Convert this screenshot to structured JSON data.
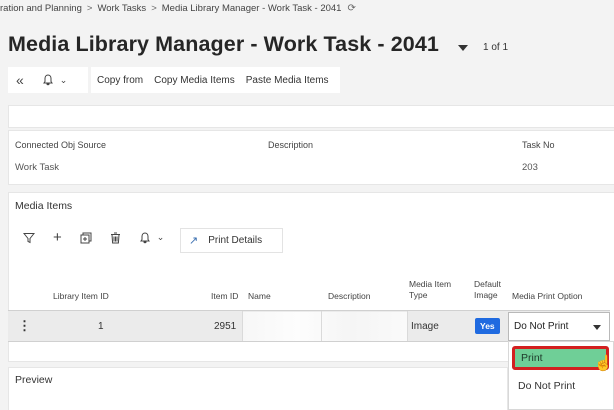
{
  "breadcrumb": {
    "items": [
      "ration and Planning",
      "Work Tasks",
      "Media Library Manager - Work Task - 2041"
    ],
    "refresh_icon": "refresh-icon"
  },
  "header": {
    "title": "Media Library Manager - Work Task - 2041",
    "pager": "1 of 1"
  },
  "toolbar": {
    "copy_from": "Copy from",
    "copy_media_items": "Copy Media Items",
    "paste_media_items": "Paste Media Items"
  },
  "info": {
    "connected_obj_source_label": "Connected Obj Source",
    "connected_obj_source_value": "Work Task",
    "description_label": "Description",
    "task_no_label": "Task No",
    "task_no_value": "203"
  },
  "media_items": {
    "section_title": "Media Items",
    "print_details": "Print Details",
    "columns": {
      "library_item_id": "Library Item ID",
      "item_id": "Item ID",
      "name": "Name",
      "description": "Description",
      "media_item_type": [
        "Media Item",
        "Type"
      ],
      "default_image": [
        "Default",
        "Image"
      ],
      "media_print_option": "Media Print Option"
    },
    "rows": [
      {
        "library_item_id": "1",
        "item_id": "2951",
        "name": "",
        "description": "",
        "media_item_type": "Image",
        "default_image": "Yes",
        "media_print_option": "Do Not Print"
      }
    ]
  },
  "dropdown": {
    "options": [
      "Print",
      "Do Not Print"
    ],
    "highlighted": "Print"
  },
  "preview": {
    "section_title": "Preview"
  },
  "colors": {
    "accent": "#1f6ae0",
    "highlight": "#6fcf97",
    "callout": "#d32020"
  }
}
